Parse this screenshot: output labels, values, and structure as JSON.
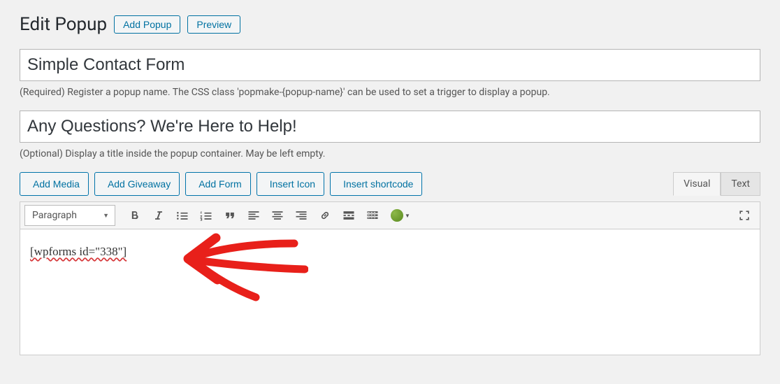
{
  "header": {
    "page_title": "Edit Popup",
    "add_popup_label": "Add Popup",
    "preview_label": "Preview"
  },
  "fields": {
    "popup_name": "Simple Contact Form",
    "popup_name_help": "(Required) Register a popup name. The CSS class 'popmake-{popup-name}' can be used to set a trigger to display a popup.",
    "popup_title": "Any Questions? We're Here to Help!",
    "popup_title_help": "(Optional) Display a title inside the popup container. May be left empty."
  },
  "editor": {
    "buttons": {
      "add_media": "Add Media",
      "add_giveaway": "Add Giveaway",
      "add_form": "Add Form",
      "insert_icon": "Insert Icon",
      "insert_shortcode": "Insert shortcode"
    },
    "tabs": {
      "visual": "Visual",
      "text": "Text"
    },
    "format_select": "Paragraph",
    "content": "[wpforms id=\"338\"]"
  }
}
